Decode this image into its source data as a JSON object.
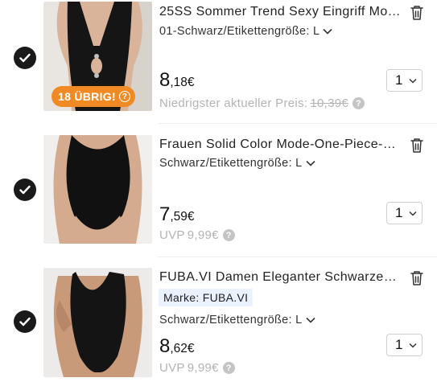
{
  "items": [
    {
      "selected": true,
      "title": "25SS Sommer Trend Sexy Eingriff Mo…",
      "variant": "01-Schwarz/Etikettengröße: L",
      "price_int": "8",
      "price_dec": ",18€",
      "sub_label": "Niedrigster aktueller Preis:",
      "sub_price": "10,39€",
      "quantity": "1",
      "badge": "18 ÜBRIG!"
    },
    {
      "selected": true,
      "title": "Frauen Solid Color Mode-One-Piece-…",
      "variant": "Schwarz/Etikettengröße: L",
      "price_int": "7",
      "price_dec": ",59€",
      "sub_label": "UVP",
      "sub_price": "9,99€",
      "quantity": "1"
    },
    {
      "selected": true,
      "title": "FUBA.VI Damen Eleganter Schwarzer…",
      "brand": "Marke: FUBA.VI",
      "variant": "Schwarz/Etikettengröße: L",
      "price_int": "8",
      "price_dec": ",62€",
      "sub_label": "UVP",
      "sub_price": "9,99€",
      "quantity": "1"
    }
  ],
  "icons": {
    "check": "check-icon",
    "trash": "trash-icon",
    "chevron": "chevron-down-icon",
    "help": "question-icon"
  },
  "colors": {
    "badge": "#f08a24",
    "brand_bg": "#eaf2ff",
    "muted": "#b3b3b3"
  }
}
